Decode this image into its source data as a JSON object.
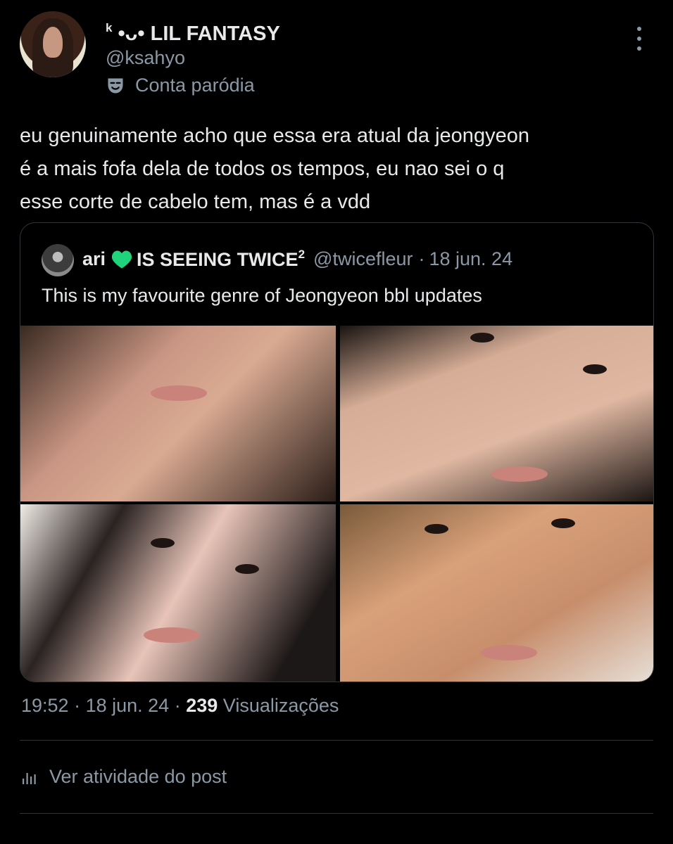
{
  "post": {
    "author_name_prefix": "k",
    "author_name": "•ᴗ• LIL FANTASY",
    "author_handle": "@ksahyo",
    "parody_label": "Conta paródia",
    "text_lines": [
      "eu genuinamente acho que essa era atual da jeongyeon",
      "é a mais fofa dela de todos os tempos, eu nao sei o q",
      "esse corte de cabelo tem, mas é a vdd"
    ],
    "time": "19:52",
    "date": "18 jun. 24",
    "views_count": "239",
    "views_label": "Visualizações",
    "activity_label": "Ver atividade do post"
  },
  "quote": {
    "name_start": "ari",
    "name_end": "IS SEEING TWICE",
    "name_sup": "2",
    "handle": "@twicefleur",
    "separator": "·",
    "date": "18 jun. 24",
    "text": "This is my favourite genre of Jeongyeon bbl updates"
  },
  "icons": {
    "more": "more-vertical-icon",
    "parody": "theater-mask-icon",
    "heart": "green-heart-icon",
    "activity": "bar-chart-icon"
  },
  "colors": {
    "background": "#000000",
    "text_primary": "#e7e9ea",
    "text_secondary": "#8b98a5",
    "border": "#333639",
    "heart": "#1fd47a"
  }
}
